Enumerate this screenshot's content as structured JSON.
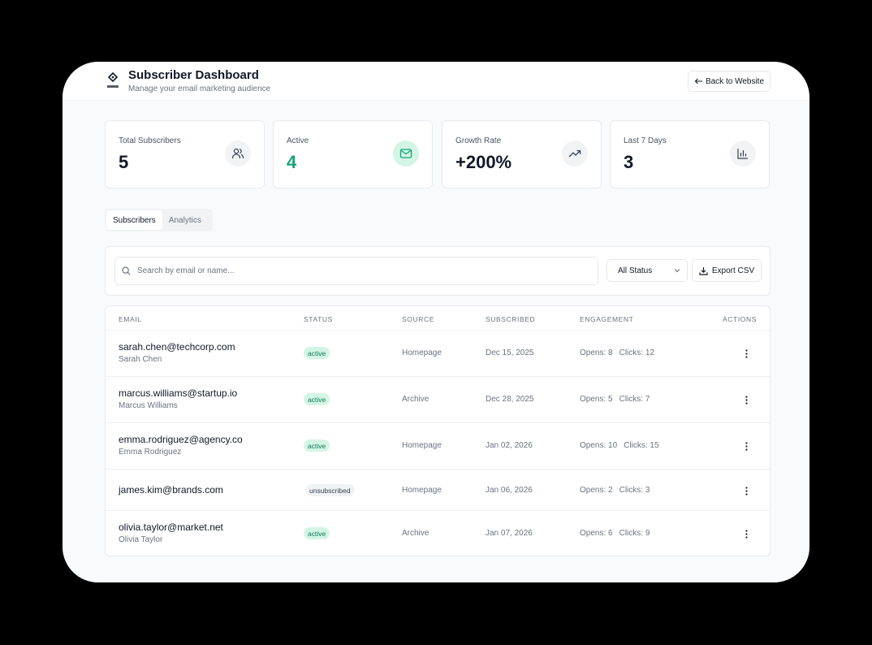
{
  "header": {
    "title": "Subscriber Dashboard",
    "subtitle": "Manage your email marketing audience",
    "back_label": "Back to Website"
  },
  "stats": [
    {
      "label": "Total Subscribers",
      "value": "5",
      "icon": "users-icon"
    },
    {
      "label": "Active",
      "value": "4",
      "icon": "mail-icon",
      "accent": "#16a37a"
    },
    {
      "label": "Growth Rate",
      "value": "+200%",
      "icon": "trending-up-icon"
    },
    {
      "label": "Last 7 Days",
      "value": "3",
      "icon": "bar-chart-icon"
    }
  ],
  "tabs": [
    {
      "label": "Subscribers",
      "active": true
    },
    {
      "label": "Analytics",
      "active": false
    }
  ],
  "toolbar": {
    "search_placeholder": "Search by email or name...",
    "status_filter": "All Status",
    "export_label": "Export CSV"
  },
  "table": {
    "columns": [
      "EMAIL",
      "STATUS",
      "SOURCE",
      "SUBSCRIBED",
      "ENGAGEMENT",
      "ACTIONS"
    ],
    "rows": [
      {
        "email": "sarah.chen@techcorp.com",
        "name": "Sarah Chen",
        "status": "active",
        "source": "Homepage",
        "subscribed": "Dec 15, 2025",
        "opens": "Opens: 8",
        "clicks": "Clicks: 12"
      },
      {
        "email": "marcus.williams@startup.io",
        "name": "Marcus Williams",
        "status": "active",
        "source": "Archive",
        "subscribed": "Dec 28, 2025",
        "opens": "Opens: 5",
        "clicks": "Clicks: 7"
      },
      {
        "email": "emma.rodriguez@agency.co",
        "name": "Emma Rodriguez",
        "status": "active",
        "source": "Homepage",
        "subscribed": "Jan 02, 2026",
        "opens": "Opens: 10",
        "clicks": "Clicks: 15"
      },
      {
        "email": "james.kim@brands.com",
        "name": "",
        "status": "unsubscribed",
        "source": "Homepage",
        "subscribed": "Jan 06, 2026",
        "opens": "Opens: 2",
        "clicks": "Clicks: 3"
      },
      {
        "email": "olivia.taylor@market.net",
        "name": "Olivia Taylor",
        "status": "active",
        "source": "Archive",
        "subscribed": "Jan 07, 2026",
        "opens": "Opens: 6",
        "clicks": "Clicks: 9"
      }
    ]
  },
  "colors": {
    "accent_green": "#16a37a",
    "badge_green_bg": "#d3f5e6"
  }
}
